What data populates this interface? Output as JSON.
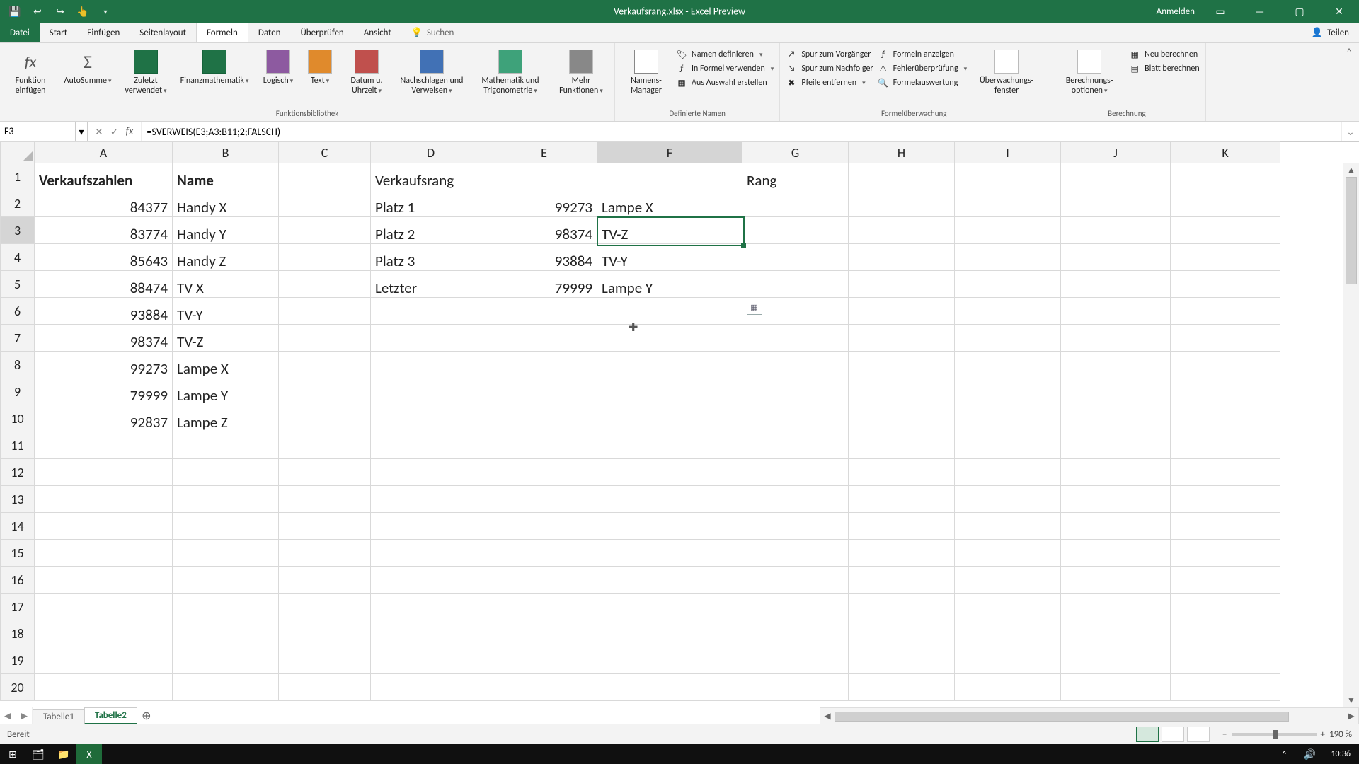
{
  "window_title": "Verkaufsrang.xlsx - Excel Preview",
  "titlebar": {
    "sign_in": "Anmelden"
  },
  "tabs": {
    "file": "Datei",
    "start": "Start",
    "insert": "Einfügen",
    "pagelayout": "Seitenlayout",
    "formulas": "Formeln",
    "data": "Daten",
    "review": "Überprüfen",
    "view": "Ansicht",
    "search": "Suchen",
    "share": "Teilen"
  },
  "ribbon": {
    "groups": {
      "lib": "Funktionsbibliothek",
      "names": "Definierte Namen",
      "audit": "Formelüberwachung",
      "calc": "Berechnung"
    },
    "buttons": {
      "insert_fn": "Funktion einfügen",
      "autosum": "AutoSumme",
      "recent": "Zuletzt verwendet",
      "financial": "Finanzmathematik",
      "logical": "Logisch",
      "text": "Text",
      "datetime": "Datum u. Uhrzeit",
      "lookup": "Nachschlagen und Verweisen",
      "math": "Mathematik und Trigonometrie",
      "more": "Mehr Funktionen",
      "name_mgr": "Namens-Manager",
      "define_name": "Namen definieren",
      "use_in_formula": "In Formel verwenden",
      "create_from_sel": "Aus Auswahl erstellen",
      "trace_prec": "Spur zum Vorgänger",
      "trace_dep": "Spur zum Nachfolger",
      "remove_arrows": "Pfeile entfernen",
      "show_formulas": "Formeln anzeigen",
      "error_check": "Fehlerüberprüfung",
      "eval_formula": "Formelauswertung",
      "watch": "Überwachungs-fenster",
      "calc_opts": "Berechnungs-optionen",
      "calc_now": "Neu berechnen",
      "calc_sheet": "Blatt berechnen"
    }
  },
  "formula_bar": {
    "cell_ref": "F3",
    "formula": "=SVERWEIS(E3;A3:B11;2;FALSCH)"
  },
  "columns": [
    "A",
    "B",
    "C",
    "D",
    "E",
    "F",
    "G",
    "H",
    "I",
    "J",
    "K"
  ],
  "rows": 20,
  "active_col_index": 5,
  "active_row_index": 2,
  "cells": {
    "A1": {
      "v": "Verkaufszahlen",
      "bold": true
    },
    "B1": {
      "v": "Name",
      "bold": true
    },
    "D1": {
      "v": "Verkaufsrang"
    },
    "G1": {
      "v": "Rang"
    },
    "A2": {
      "v": "84377",
      "num": true
    },
    "B2": {
      "v": "Handy X"
    },
    "D2": {
      "v": "Platz 1"
    },
    "E2": {
      "v": "99273",
      "num": true
    },
    "F2": {
      "v": "Lampe X"
    },
    "A3": {
      "v": "83774",
      "num": true
    },
    "B3": {
      "v": "Handy Y"
    },
    "D3": {
      "v": "Platz 2"
    },
    "E3": {
      "v": "98374",
      "num": true
    },
    "F3": {
      "v": "TV-Z"
    },
    "A4": {
      "v": "85643",
      "num": true
    },
    "B4": {
      "v": "Handy Z"
    },
    "D4": {
      "v": "Platz 3"
    },
    "E4": {
      "v": "93884",
      "num": true
    },
    "F4": {
      "v": "TV-Y"
    },
    "A5": {
      "v": "88474",
      "num": true
    },
    "B5": {
      "v": "TV X"
    },
    "D5": {
      "v": "Letzter"
    },
    "E5": {
      "v": "79999",
      "num": true
    },
    "F5": {
      "v": "Lampe Y"
    },
    "A6": {
      "v": "93884",
      "num": true
    },
    "B6": {
      "v": "TV-Y"
    },
    "A7": {
      "v": "98374",
      "num": true
    },
    "B7": {
      "v": "TV-Z"
    },
    "A8": {
      "v": "99273",
      "num": true
    },
    "B8": {
      "v": "Lampe X"
    },
    "A9": {
      "v": "79999",
      "num": true
    },
    "B9": {
      "v": "Lampe Y"
    },
    "A10": {
      "v": "92837",
      "num": true
    },
    "B10": {
      "v": "Lampe Z"
    }
  },
  "col_widths": {
    "A": 195,
    "B": 150,
    "C": 130,
    "D": 170,
    "E": 150,
    "F": 205,
    "G": 150,
    "H": 150,
    "I": 150,
    "J": 155,
    "K": 155
  },
  "sheets": {
    "tab1": "Tabelle1",
    "tab2": "Tabelle2"
  },
  "status": {
    "ready": "Bereit",
    "zoom": "190 %"
  },
  "taskbar": {
    "time": "10:36"
  }
}
